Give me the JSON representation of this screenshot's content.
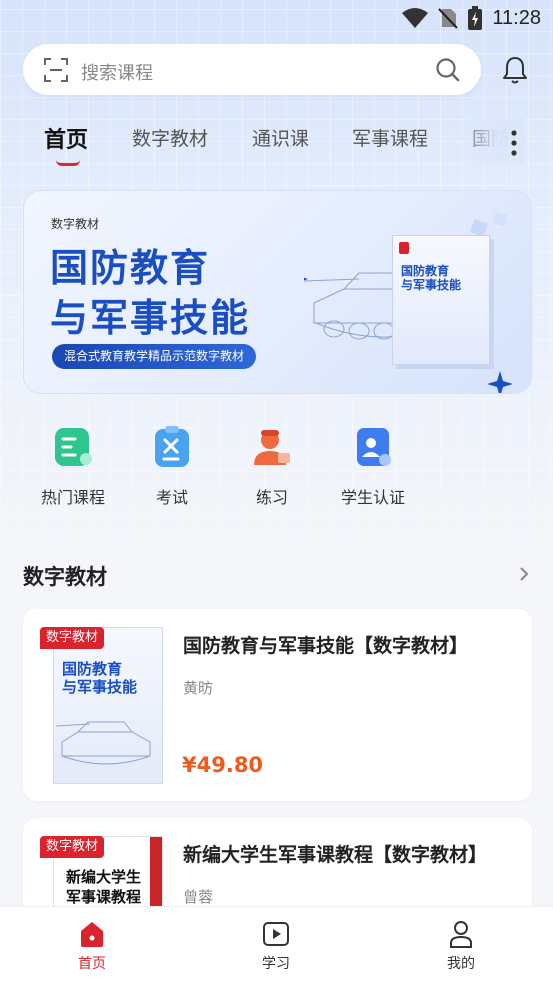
{
  "status_bar": {
    "time": "11:28"
  },
  "search": {
    "placeholder": "搜索课程"
  },
  "tabs": [
    {
      "label": "首页",
      "active": true
    },
    {
      "label": "数字教材"
    },
    {
      "label": "通识课"
    },
    {
      "label": "军事课程"
    },
    {
      "label": "国防"
    }
  ],
  "banner": {
    "kicker": "数字教材",
    "title_line1": "国防教育",
    "title_line2": "与军事技能",
    "subtitle": "混合式教育教学精品示范数字教材",
    "book_title": "国防教育\n与军事技能"
  },
  "quick_actions": [
    {
      "label": "热门课程",
      "icon": "hot-courses-icon",
      "color": "#2fc58f"
    },
    {
      "label": "考试",
      "icon": "exam-icon",
      "color": "#4aa3f0"
    },
    {
      "label": "练习",
      "icon": "practice-icon",
      "color": "#f06a3f"
    },
    {
      "label": "学生认证",
      "icon": "student-auth-icon",
      "color": "#3f7cf0"
    }
  ],
  "section": {
    "title": "数字教材"
  },
  "books": [
    {
      "tag": "数字教材",
      "title": "国防教育与军事技能【数字教材】",
      "author": "黄昉",
      "price": "¥49.80",
      "cover_text": "国防教育\n与军事技能"
    },
    {
      "tag": "数字教材",
      "title": "新编大学生军事课教程【数字教材】",
      "author": "曾蓉",
      "cover_text": "新编大学生\n军事课教程"
    }
  ],
  "bottom_nav": [
    {
      "label": "首页",
      "icon": "home-icon",
      "active": true
    },
    {
      "label": "学习",
      "icon": "play-icon"
    },
    {
      "label": "我的",
      "icon": "profile-icon"
    }
  ],
  "colors": {
    "accent": "#d9232d",
    "price": "#ee5b1c",
    "brand_blue": "#1b4fc1"
  }
}
